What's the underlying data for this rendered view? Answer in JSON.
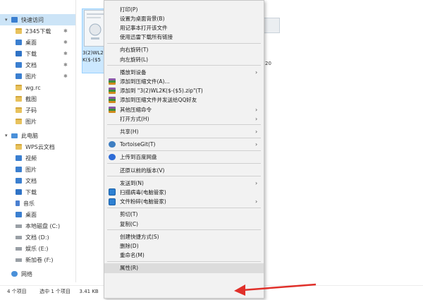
{
  "sidebar": {
    "quick_access": "快速访问",
    "items": [
      {
        "label": "2345下载",
        "icon": "folder-icon"
      },
      {
        "label": "桌面",
        "icon": "desktop-icon"
      },
      {
        "label": "下载",
        "icon": "download-icon"
      },
      {
        "label": "文档",
        "icon": "documents-icon"
      },
      {
        "label": "图片",
        "icon": "pictures-icon"
      },
      {
        "label": "wg.rc",
        "icon": "folder-icon"
      },
      {
        "label": "截图",
        "icon": "folder-icon"
      },
      {
        "label": "子码",
        "icon": "folder-icon"
      },
      {
        "label": "图片",
        "icon": "folder-icon"
      }
    ],
    "this_pc": "此电脑",
    "pc_items": [
      {
        "label": "WPS云文档",
        "icon": "folder-icon"
      },
      {
        "label": "视频",
        "icon": "videos-icon"
      },
      {
        "label": "图片",
        "icon": "pictures-icon"
      },
      {
        "label": "文档",
        "icon": "documents-icon"
      },
      {
        "label": "下载",
        "icon": "download-icon"
      },
      {
        "label": "音乐",
        "icon": "music-icon"
      },
      {
        "label": "桌面",
        "icon": "desktop-icon"
      },
      {
        "label": "本地磁盘 (C:)",
        "icon": "drive-icon"
      },
      {
        "label": "文档 (D:)",
        "icon": "drive-icon"
      },
      {
        "label": "娱乐 (E:)",
        "icon": "drive-icon"
      },
      {
        "label": "新加卷 (F:)",
        "icon": "drive-icon"
      }
    ],
    "network": "网络"
  },
  "file": {
    "name_line1": "3(2)WL2",
    "name_line2": "K($-($5"
  },
  "side_snippet": "20",
  "status": {
    "count": "4 个项目",
    "selected": "选中 1 个项目",
    "size": "3.41 KB"
  },
  "menu": {
    "items": [
      {
        "label": "打印(P)"
      },
      {
        "label": "设置为桌面背景(B)"
      },
      {
        "label": "用记事本打开该文件"
      },
      {
        "label": "使用迅雷下载所有链接"
      },
      {
        "sep": true
      },
      {
        "label": "向右旋转(T)"
      },
      {
        "label": "向左旋转(L)"
      },
      {
        "sep": true
      },
      {
        "label": "播放到设备",
        "arrow": true
      },
      {
        "label": "添加到压缩文件(A)...",
        "icon": "rar"
      },
      {
        "label": "添加到 \"3(2)WL2K($-($5).zip\"(T)",
        "icon": "rar"
      },
      {
        "label": "添加到压缩文件并发送给QQ好友",
        "icon": "rar"
      },
      {
        "label": "其他压缩命令",
        "icon": "rar",
        "arrow": true
      },
      {
        "label": "打开方式(H)",
        "arrow": true
      },
      {
        "sep": true
      },
      {
        "label": "共享(H)",
        "arrow": true
      },
      {
        "sep": true
      },
      {
        "label": "TortoiseGit(T)",
        "icon": "tortoise",
        "arrow": true
      },
      {
        "sep": true
      },
      {
        "label": "上传到百度网盘",
        "icon": "baidu"
      },
      {
        "sep": true
      },
      {
        "label": "还原以前的版本(V)"
      },
      {
        "sep": true
      },
      {
        "label": "发送到(N)",
        "arrow": true
      },
      {
        "label": "扫描病毒(电脑管家)",
        "icon": "shield"
      },
      {
        "label": "文件粉碎(电脑管家)",
        "icon": "shield",
        "arrow": true
      },
      {
        "sep": true
      },
      {
        "label": "剪切(T)"
      },
      {
        "label": "复制(C)"
      },
      {
        "sep": true
      },
      {
        "label": "创建快捷方式(S)"
      },
      {
        "label": "删除(D)"
      },
      {
        "label": "重命名(M)"
      },
      {
        "sep": true
      },
      {
        "label": "属性(R)",
        "highlight": true
      }
    ]
  },
  "colors": {
    "selection": "#cce8ff",
    "menu_bg": "#f2f2f2",
    "arrow": "#e0302a",
    "quick_access_bg": "#cce4f7"
  }
}
